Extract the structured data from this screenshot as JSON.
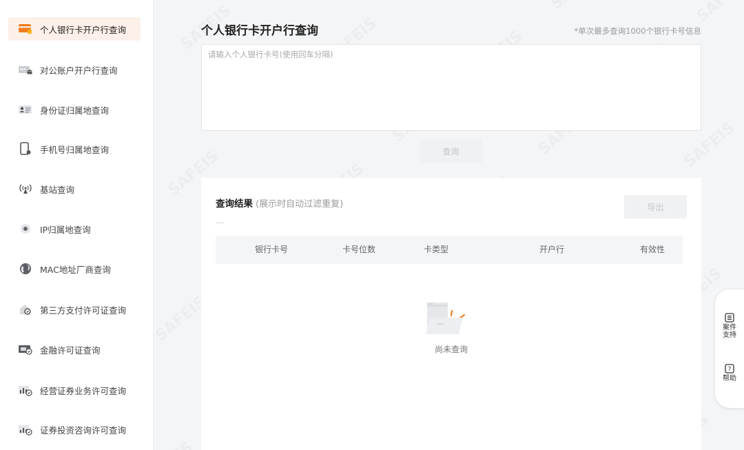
{
  "sidebar": {
    "items": [
      {
        "label": "个人银行卡开户行查询",
        "icon": "bank-card-icon",
        "active": true
      },
      {
        "label": "对公账户开户行查询",
        "icon": "corporate-account-icon"
      },
      {
        "label": "身份证归属地查询",
        "icon": "id-card-icon"
      },
      {
        "label": "手机号归属地查询",
        "icon": "mobile-phone-icon"
      },
      {
        "label": "基站查询",
        "icon": "base-station-icon"
      },
      {
        "label": "IP归属地查询",
        "icon": "location-pin-icon"
      },
      {
        "label": "MAC地址厂商查询",
        "icon": "globe-icon"
      },
      {
        "label": "第三方支付许可证查询",
        "icon": "payment-license-icon"
      },
      {
        "label": "金融许可证查询",
        "icon": "finance-license-icon"
      },
      {
        "label": "经营证券业务许可查询",
        "icon": "securities-license-icon"
      },
      {
        "label": "证券投资咨询许可查询",
        "icon": "investment-advisory-icon"
      }
    ]
  },
  "main": {
    "title": "个人银行卡开户行查询",
    "limit_note": "*单次最多查询1000个银行卡号信息",
    "input_placeholder": "请输入个人银行卡号(使用回车分隔)",
    "query_label": "查询"
  },
  "results": {
    "title": "查询结果",
    "note": "(展示时自动过滤重复)",
    "export_label": "导出",
    "columns": [
      "银行卡号",
      "卡号位数",
      "卡类型",
      "开户行",
      "有效性"
    ],
    "empty_text": "尚未查询"
  },
  "float_widget": {
    "case_support_line1": "案件",
    "case_support_line2": "支持",
    "help_label": "帮助"
  },
  "colors": {
    "accent": "#f07d1e",
    "active_bg": "#fdf0e8"
  }
}
